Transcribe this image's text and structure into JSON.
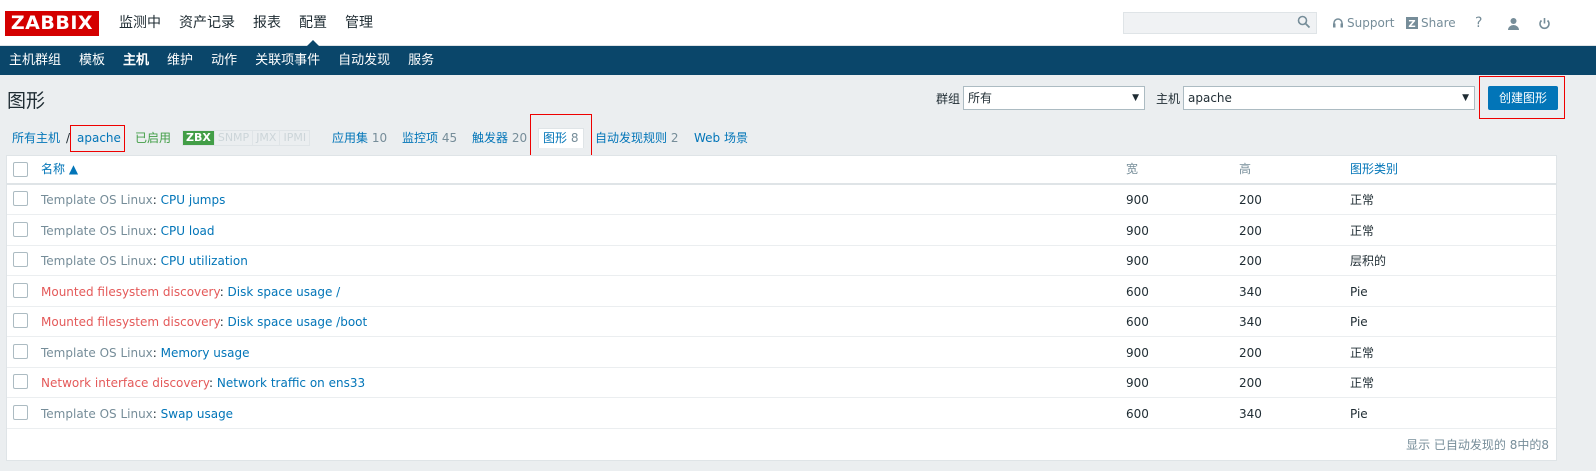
{
  "header": {
    "logo": "ZABBIX",
    "nav": [
      "监测中",
      "资产记录",
      "报表",
      "配置",
      "管理"
    ],
    "active_nav": 3,
    "search_placeholder": "",
    "support_label": "Support",
    "share_label": "Share",
    "help_label": "?"
  },
  "subnav": {
    "items": [
      "主机群组",
      "模板",
      "主机",
      "维护",
      "动作",
      "关联项事件",
      "自动发现",
      "服务"
    ],
    "active": 2
  },
  "page": {
    "title": "图形",
    "group_label": "群组",
    "group_value": "所有",
    "host_label": "主机",
    "host_value": "apache",
    "create_button": "创建图形"
  },
  "breadcrumb": {
    "all_hosts": "所有主机",
    "separator": "/",
    "host": "apache",
    "status": "已启用",
    "badges": [
      "ZBX",
      "SNMP",
      "JMX",
      "IPMI"
    ],
    "apps_label": "应用集",
    "apps_count": "10",
    "items_label": "监控项",
    "items_count": "45",
    "triggers_label": "触发器",
    "triggers_count": "20",
    "graphs_label": "图形",
    "graphs_count": "8",
    "discovery_label": "自动发现规则",
    "discovery_count": "2",
    "web_label": "Web 场景"
  },
  "table": {
    "columns": {
      "name": "名称 ▲",
      "width": "宽",
      "height": "高",
      "type": "图形类别"
    },
    "rows": [
      {
        "prefix": "Template OS Linux",
        "prefix_color": "grey",
        "name": "CPU jumps",
        "width": "900",
        "height": "200",
        "type": "正常"
      },
      {
        "prefix": "Template OS Linux",
        "prefix_color": "grey",
        "name": "CPU load",
        "width": "900",
        "height": "200",
        "type": "正常"
      },
      {
        "prefix": "Template OS Linux",
        "prefix_color": "grey",
        "name": "CPU utilization",
        "width": "900",
        "height": "200",
        "type": "层积的"
      },
      {
        "prefix": "Mounted filesystem discovery",
        "prefix_color": "orange",
        "name": "Disk space usage /",
        "width": "600",
        "height": "340",
        "type": "Pie"
      },
      {
        "prefix": "Mounted filesystem discovery",
        "prefix_color": "orange",
        "name": "Disk space usage /boot",
        "width": "600",
        "height": "340",
        "type": "Pie"
      },
      {
        "prefix": "Template OS Linux",
        "prefix_color": "grey",
        "name": "Memory usage",
        "width": "900",
        "height": "200",
        "type": "正常"
      },
      {
        "prefix": "Network interface discovery",
        "prefix_color": "orange",
        "name": "Network traffic on ens33",
        "width": "900",
        "height": "200",
        "type": "正常"
      },
      {
        "prefix": "Template OS Linux",
        "prefix_color": "grey",
        "name": "Swap usage",
        "width": "600",
        "height": "340",
        "type": "Pie"
      }
    ],
    "footer": "显示 已自动发现的 8中的8"
  }
}
